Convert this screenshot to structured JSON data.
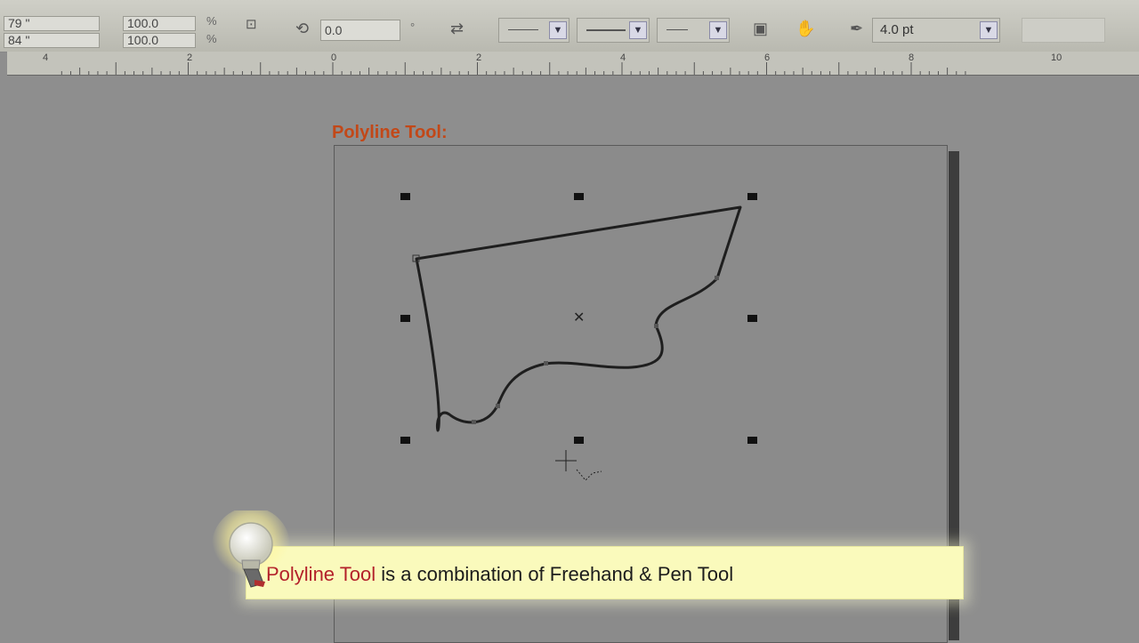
{
  "toolbar": {
    "position_x": "79 \"",
    "position_y": "84 \"",
    "scale_x": "100.0",
    "scale_y": "100.0",
    "percent_symbol": "%",
    "rotation_value": "0.0",
    "degree_symbol": "°",
    "outline_width": "4.0 pt",
    "icons": [
      "lock-ratio-icon",
      "rotate-icon",
      "mirror-icon",
      "start-arrow",
      "line-style",
      "end-arrow",
      "wrap-icon",
      "hand-icon",
      "pen-outline-icon"
    ]
  },
  "ruler": {
    "labels": [
      "4",
      "2",
      "0",
      "2",
      "4",
      "6",
      "8",
      "10"
    ]
  },
  "canvas": {
    "heading": "Polyline Tool:"
  },
  "tip": {
    "highlight": "Polyline Tool",
    "rest": " is a combination of Freehand & Pen Tool"
  },
  "colors": {
    "heading": "#c24818",
    "highlight": "#b3202a",
    "tip_bg": "#fafabc",
    "canvas_bg": "#8b8b8b"
  }
}
